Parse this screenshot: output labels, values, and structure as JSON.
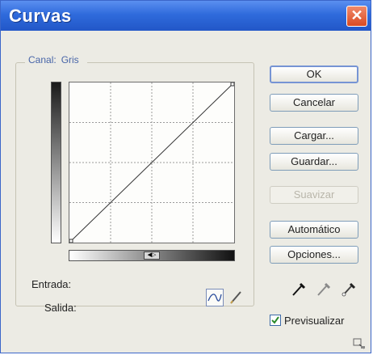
{
  "dialog": {
    "title": "Curvas",
    "close_symbol": "✕"
  },
  "channel": {
    "label": "Canal:",
    "value": "Gris"
  },
  "slider_symbol": "◀▷",
  "io": {
    "input_label": "Entrada:",
    "output_label": "Salida:"
  },
  "buttons": {
    "ok": "OK",
    "cancel": "Cancelar",
    "load": "Cargar...",
    "save": "Guardar...",
    "smooth": "Suavizar",
    "auto": "Automático",
    "options": "Opciones..."
  },
  "preview": {
    "label": "Previsualizar",
    "checked": true
  },
  "icons": {
    "curve_tool": "curve-tool-icon",
    "pencil_tool": "pencil-icon",
    "black_eyedropper": "eyedropper-black-icon",
    "gray_eyedropper": "eyedropper-gray-icon",
    "white_eyedropper": "eyedropper-white-icon",
    "resize": "expand-icon"
  },
  "colors": {
    "title_bar": "#2f6bdc",
    "close_button": "#d94a22",
    "dialog_bg": "#ecebe4",
    "legend_text": "#4865a8"
  }
}
